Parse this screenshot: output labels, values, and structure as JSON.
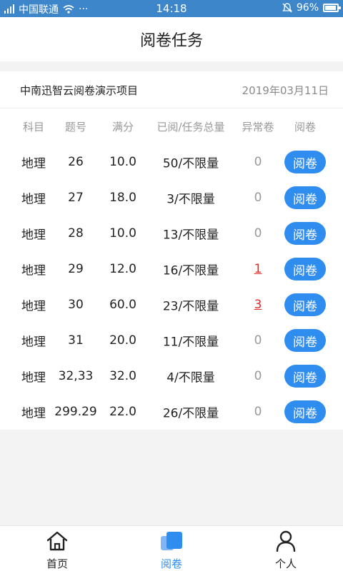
{
  "status_bar": {
    "carrier": "中国联通",
    "time": "14:18",
    "battery": "96%",
    "icons": [
      "signal-icon",
      "wifi-icon",
      "more-icon",
      "mute-icon",
      "battery-icon"
    ]
  },
  "header": {
    "title": "阅卷任务"
  },
  "project": {
    "name": "中南迅智云阅卷演示项目",
    "date": "2019年03月11日"
  },
  "table": {
    "headers": [
      "科目",
      "题号",
      "满分",
      "已阅/任务总量",
      "异常卷",
      "阅卷"
    ],
    "rows": [
      {
        "subject": "地理",
        "question": "26",
        "full_score": "10.0",
        "progress": "50/不限量",
        "abnormal": "0",
        "action": "阅卷"
      },
      {
        "subject": "地理",
        "question": "27",
        "full_score": "18.0",
        "progress": "3/不限量",
        "abnormal": "0",
        "action": "阅卷"
      },
      {
        "subject": "地理",
        "question": "28",
        "full_score": "10.0",
        "progress": "13/不限量",
        "abnormal": "0",
        "action": "阅卷"
      },
      {
        "subject": "地理",
        "question": "29",
        "full_score": "12.0",
        "progress": "16/不限量",
        "abnormal": "1",
        "action": "阅卷"
      },
      {
        "subject": "地理",
        "question": "30",
        "full_score": "60.0",
        "progress": "23/不限量",
        "abnormal": "3",
        "action": "阅卷"
      },
      {
        "subject": "地理",
        "question": "31",
        "full_score": "20.0",
        "progress": "11/不限量",
        "abnormal": "0",
        "action": "阅卷"
      },
      {
        "subject": "地理",
        "question": "32,33",
        "full_score": "32.0",
        "progress": "4/不限量",
        "abnormal": "0",
        "action": "阅卷"
      },
      {
        "subject": "地理",
        "question": "299.29",
        "full_score": "22.0",
        "progress": "26/不限量",
        "abnormal": "0",
        "action": "阅卷"
      }
    ]
  },
  "tab_bar": {
    "items": [
      {
        "label": "首页",
        "icon": "home-icon"
      },
      {
        "label": "阅卷",
        "icon": "papers-icon",
        "active": true
      },
      {
        "label": "个人",
        "icon": "person-icon"
      }
    ]
  },
  "colors": {
    "accent": "#2f8df0",
    "status_bar": "#3d86c9",
    "error": "#e02a2a"
  }
}
